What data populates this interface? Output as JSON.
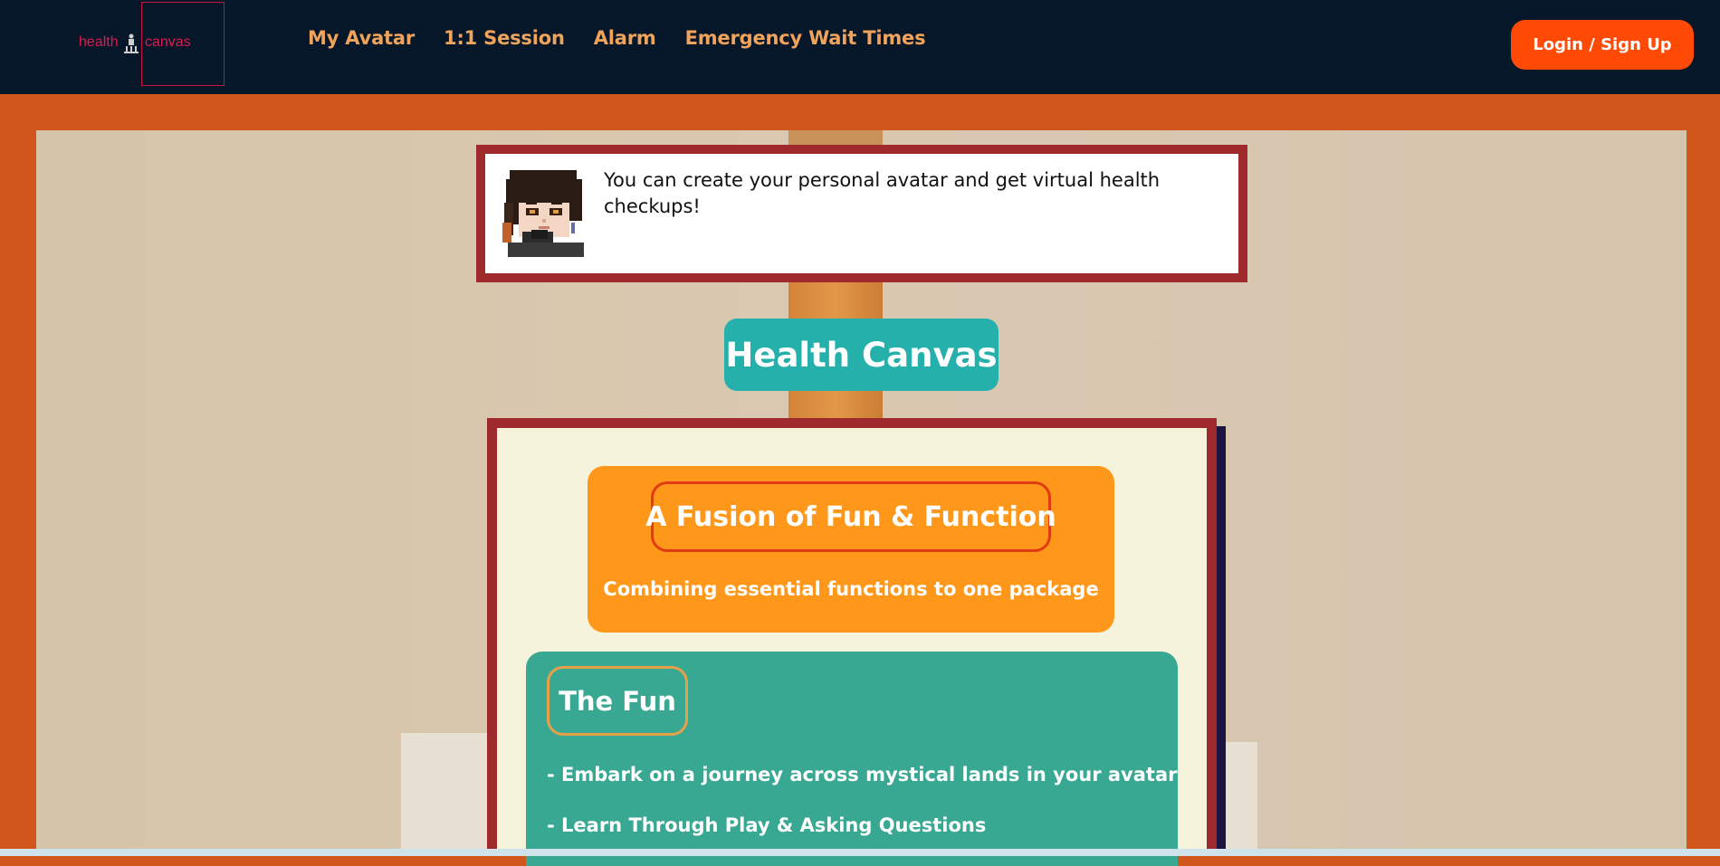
{
  "header": {
    "logo": {
      "left": "health",
      "right": "canvas"
    },
    "nav": [
      {
        "label": "My Avatar"
      },
      {
        "label": "1:1 Session"
      },
      {
        "label": "Alarm"
      },
      {
        "label": "Emergency Wait Times"
      }
    ],
    "login_label": "Login / Sign Up"
  },
  "speech": {
    "text": "You can create your personal avatar and get virtual health checkups!"
  },
  "title": "Health Canvas",
  "fusion": {
    "title": "A Fusion of Fun & Function",
    "subtitle": "Combining essential functions to one package"
  },
  "fun": {
    "title": "The Fun",
    "items": [
      "- Embark on a journey across mystical lands in your avatar",
      "- Learn Through Play & Asking Questions"
    ]
  },
  "colors": {
    "nav_bg": "#07172a",
    "nav_link": "#f0a35a",
    "login_bg": "#ff4a06",
    "page_bg": "#d1561c",
    "card_border": "#9f2a2e",
    "title_badge": "#26b0ac",
    "fusion_bg": "#ff981a",
    "fun_bg": "#39a893"
  }
}
